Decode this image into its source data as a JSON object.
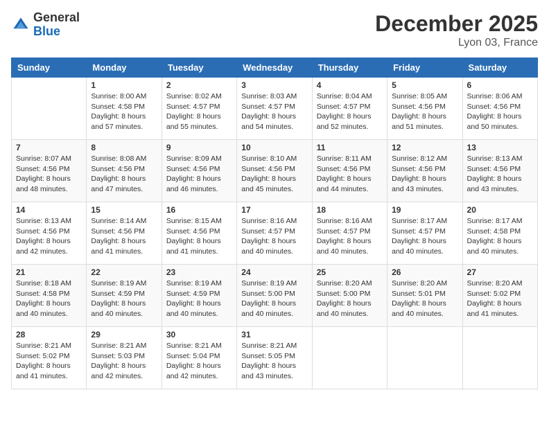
{
  "logo": {
    "general": "General",
    "blue": "Blue"
  },
  "header": {
    "title": "December 2025",
    "location": "Lyon 03, France"
  },
  "weekdays": [
    "Sunday",
    "Monday",
    "Tuesday",
    "Wednesday",
    "Thursday",
    "Friday",
    "Saturday"
  ],
  "weeks": [
    [
      {
        "day": "",
        "info": ""
      },
      {
        "day": "1",
        "info": "Sunrise: 8:00 AM\nSunset: 4:58 PM\nDaylight: 8 hours\nand 57 minutes."
      },
      {
        "day": "2",
        "info": "Sunrise: 8:02 AM\nSunset: 4:57 PM\nDaylight: 8 hours\nand 55 minutes."
      },
      {
        "day": "3",
        "info": "Sunrise: 8:03 AM\nSunset: 4:57 PM\nDaylight: 8 hours\nand 54 minutes."
      },
      {
        "day": "4",
        "info": "Sunrise: 8:04 AM\nSunset: 4:57 PM\nDaylight: 8 hours\nand 52 minutes."
      },
      {
        "day": "5",
        "info": "Sunrise: 8:05 AM\nSunset: 4:56 PM\nDaylight: 8 hours\nand 51 minutes."
      },
      {
        "day": "6",
        "info": "Sunrise: 8:06 AM\nSunset: 4:56 PM\nDaylight: 8 hours\nand 50 minutes."
      }
    ],
    [
      {
        "day": "7",
        "info": "Sunrise: 8:07 AM\nSunset: 4:56 PM\nDaylight: 8 hours\nand 48 minutes."
      },
      {
        "day": "8",
        "info": "Sunrise: 8:08 AM\nSunset: 4:56 PM\nDaylight: 8 hours\nand 47 minutes."
      },
      {
        "day": "9",
        "info": "Sunrise: 8:09 AM\nSunset: 4:56 PM\nDaylight: 8 hours\nand 46 minutes."
      },
      {
        "day": "10",
        "info": "Sunrise: 8:10 AM\nSunset: 4:56 PM\nDaylight: 8 hours\nand 45 minutes."
      },
      {
        "day": "11",
        "info": "Sunrise: 8:11 AM\nSunset: 4:56 PM\nDaylight: 8 hours\nand 44 minutes."
      },
      {
        "day": "12",
        "info": "Sunrise: 8:12 AM\nSunset: 4:56 PM\nDaylight: 8 hours\nand 43 minutes."
      },
      {
        "day": "13",
        "info": "Sunrise: 8:13 AM\nSunset: 4:56 PM\nDaylight: 8 hours\nand 43 minutes."
      }
    ],
    [
      {
        "day": "14",
        "info": "Sunrise: 8:13 AM\nSunset: 4:56 PM\nDaylight: 8 hours\nand 42 minutes."
      },
      {
        "day": "15",
        "info": "Sunrise: 8:14 AM\nSunset: 4:56 PM\nDaylight: 8 hours\nand 41 minutes."
      },
      {
        "day": "16",
        "info": "Sunrise: 8:15 AM\nSunset: 4:56 PM\nDaylight: 8 hours\nand 41 minutes."
      },
      {
        "day": "17",
        "info": "Sunrise: 8:16 AM\nSunset: 4:57 PM\nDaylight: 8 hours\nand 40 minutes."
      },
      {
        "day": "18",
        "info": "Sunrise: 8:16 AM\nSunset: 4:57 PM\nDaylight: 8 hours\nand 40 minutes."
      },
      {
        "day": "19",
        "info": "Sunrise: 8:17 AM\nSunset: 4:57 PM\nDaylight: 8 hours\nand 40 minutes."
      },
      {
        "day": "20",
        "info": "Sunrise: 8:17 AM\nSunset: 4:58 PM\nDaylight: 8 hours\nand 40 minutes."
      }
    ],
    [
      {
        "day": "21",
        "info": "Sunrise: 8:18 AM\nSunset: 4:58 PM\nDaylight: 8 hours\nand 40 minutes."
      },
      {
        "day": "22",
        "info": "Sunrise: 8:19 AM\nSunset: 4:59 PM\nDaylight: 8 hours\nand 40 minutes."
      },
      {
        "day": "23",
        "info": "Sunrise: 8:19 AM\nSunset: 4:59 PM\nDaylight: 8 hours\nand 40 minutes."
      },
      {
        "day": "24",
        "info": "Sunrise: 8:19 AM\nSunset: 5:00 PM\nDaylight: 8 hours\nand 40 minutes."
      },
      {
        "day": "25",
        "info": "Sunrise: 8:20 AM\nSunset: 5:00 PM\nDaylight: 8 hours\nand 40 minutes."
      },
      {
        "day": "26",
        "info": "Sunrise: 8:20 AM\nSunset: 5:01 PM\nDaylight: 8 hours\nand 40 minutes."
      },
      {
        "day": "27",
        "info": "Sunrise: 8:20 AM\nSunset: 5:02 PM\nDaylight: 8 hours\nand 41 minutes."
      }
    ],
    [
      {
        "day": "28",
        "info": "Sunrise: 8:21 AM\nSunset: 5:02 PM\nDaylight: 8 hours\nand 41 minutes."
      },
      {
        "day": "29",
        "info": "Sunrise: 8:21 AM\nSunset: 5:03 PM\nDaylight: 8 hours\nand 42 minutes."
      },
      {
        "day": "30",
        "info": "Sunrise: 8:21 AM\nSunset: 5:04 PM\nDaylight: 8 hours\nand 42 minutes."
      },
      {
        "day": "31",
        "info": "Sunrise: 8:21 AM\nSunset: 5:05 PM\nDaylight: 8 hours\nand 43 minutes."
      },
      {
        "day": "",
        "info": ""
      },
      {
        "day": "",
        "info": ""
      },
      {
        "day": "",
        "info": ""
      }
    ]
  ]
}
